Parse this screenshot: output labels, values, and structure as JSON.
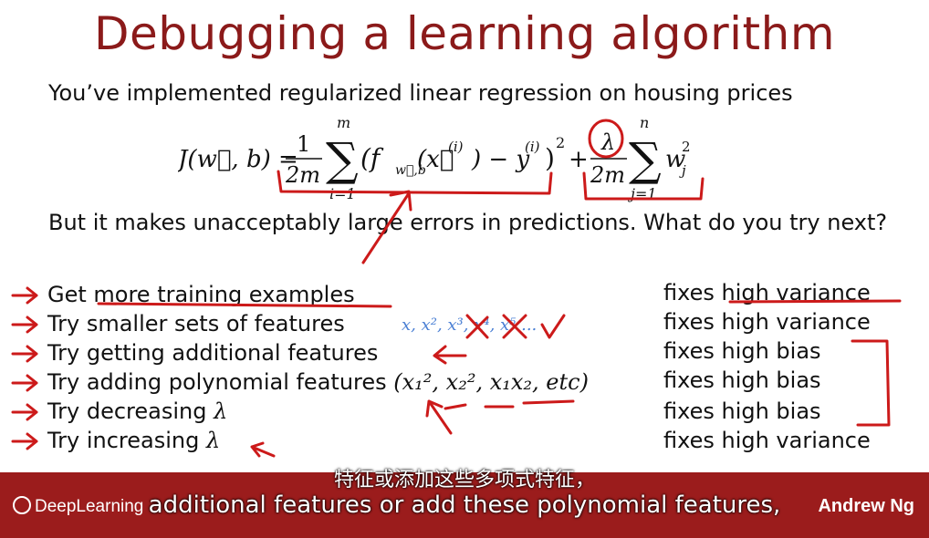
{
  "slide": {
    "title": "Debugging a learning algorithm",
    "intro": "You’ve implemented regularized linear regression on housing prices",
    "formula": {
      "lhs": "J(w⃗, b) =",
      "frac1_num": "1",
      "frac1_den": "2m",
      "sum1_top": "m",
      "sum1_bottom": "i=1",
      "term1": "(f",
      "term1_sub": "w⃗,b",
      "term1_rest": "(x⃗",
      "term1_sup": "(i)",
      "term1_minus": ") − y",
      "term1_sup2": "(i)",
      "term1_close": ")",
      "term1_power": "2",
      "plus": "+",
      "frac2_num": "λ",
      "frac2_den": "2m",
      "sum2_top": "n",
      "sum2_bottom": "j=1",
      "term2": "w",
      "term2_sub": "j",
      "term2_sup": "2"
    },
    "question": "But it makes unacceptably large errors in predictions. What do you try next?",
    "options": [
      {
        "text": "Get more training examples",
        "fix": "fixes high variance"
      },
      {
        "text": "Try smaller sets of features",
        "fix": "fixes high variance"
      },
      {
        "text": "Try getting additional features",
        "fix": "fixes high bias"
      },
      {
        "text": "Try adding polynomial features",
        "extra": "(x₁², x₂², x₁x₂, etc)",
        "fix": "fixes high bias"
      },
      {
        "text": "Try decreasing",
        "extra": "λ",
        "fix": "fixes high bias"
      },
      {
        "text": "Try increasing",
        "extra": "λ",
        "fix": "fixes high variance"
      }
    ],
    "handwritten_features": "x, x², x³, x⁴, x⁵ ..."
  },
  "footer": {
    "logo": "DeepLearning",
    "author": "Andrew Ng"
  },
  "subtitles": {
    "chinese": "特征或添加这些多项式特征，",
    "english": "additional features or add these polynomial features,"
  },
  "colors": {
    "title": "#8b1a1a",
    "banner": "#9b1c1c",
    "annotation": "#cc1a1a",
    "handwriting_blue": "#4a7fd4"
  }
}
